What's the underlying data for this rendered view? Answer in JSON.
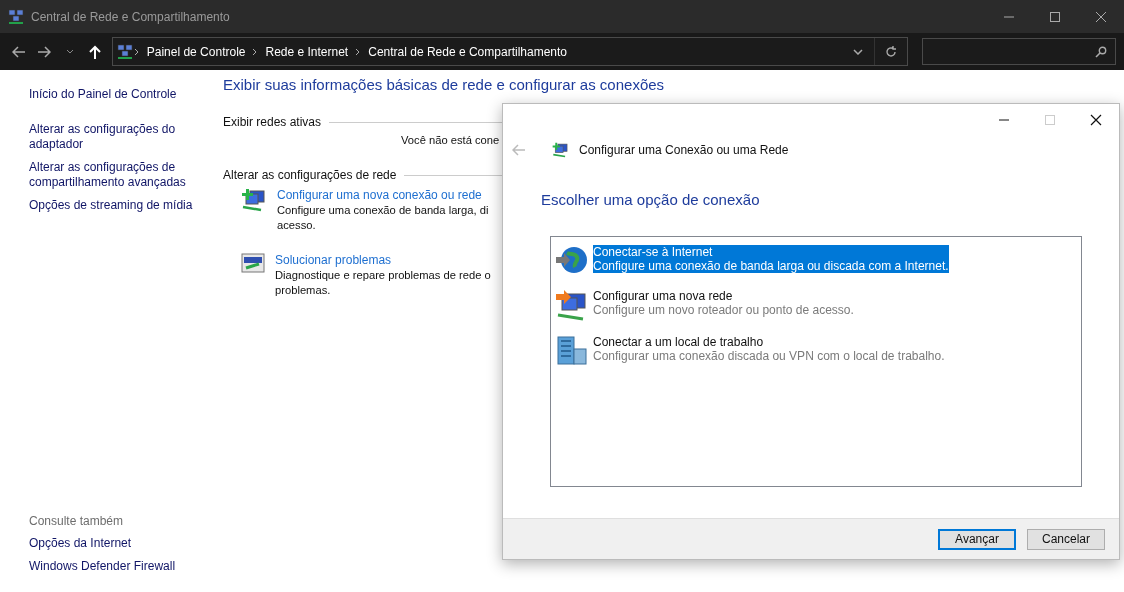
{
  "window": {
    "title": "Central de Rede e Compartilhamento"
  },
  "nav": {
    "breadcrumbs": [
      "Painel de Controle",
      "Rede e Internet",
      "Central de Rede e Compartilhamento"
    ]
  },
  "sidebar": {
    "links": [
      "Início do Painel de Controle",
      "Alterar as configurações do adaptador",
      "Alterar as configurações de compartilhamento avançadas",
      "Opções de streaming de mídia"
    ],
    "see_also": {
      "title": "Consulte também",
      "links": [
        "Opções da Internet",
        "Windows Defender Firewall"
      ]
    }
  },
  "content": {
    "heading": "Exibir suas informações básicas de rede e configurar as conexões",
    "active_networks": {
      "title": "Exibir redes ativas",
      "message": "Você não está cone"
    },
    "change_settings": {
      "title": "Alterar as configurações de rede",
      "tasks": [
        {
          "kind": "setup",
          "link": "Configurar uma nova conexão ou rede",
          "description": [
            "Configure uma conexão de banda larga, di",
            "acesso."
          ]
        },
        {
          "kind": "troubleshoot",
          "link": "Solucionar problemas",
          "description": [
            "Diagnostique e repare problemas de rede o",
            "problemas."
          ]
        }
      ]
    }
  },
  "dialog": {
    "title": "Configurar uma Conexão ou uma Rede",
    "heading": "Escolher uma opção de conexão",
    "options": [
      {
        "kind": "internet",
        "title": "Conectar-se à Internet",
        "description": "Configure uma conexão de banda larga ou discada com a Internet.",
        "selected": true
      },
      {
        "kind": "network",
        "title": "Configurar uma nova rede",
        "description": "Configure um novo roteador ou ponto de acesso.",
        "selected": false
      },
      {
        "kind": "workplace",
        "title": "Conectar a um local de trabalho",
        "description": "Configurar uma conexão discada ou VPN com o local de trabalho.",
        "selected": false
      }
    ],
    "buttons": [
      {
        "label": "Avançar",
        "default": true
      },
      {
        "label": "Cancelar",
        "default": false
      }
    ]
  }
}
